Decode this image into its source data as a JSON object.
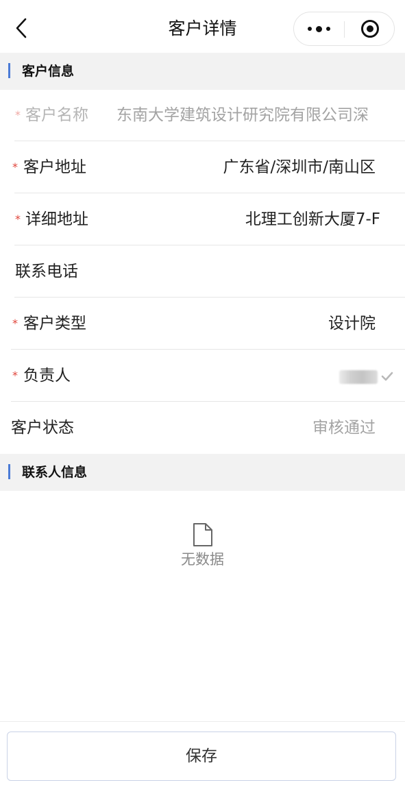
{
  "navbar": {
    "title": "客户详情"
  },
  "sections": {
    "customer_info": "客户信息",
    "contact_info": "联系人信息"
  },
  "fields": {
    "name": {
      "label": "客户名称",
      "value": "东南大学建筑设计研究院有限公司深",
      "required": true,
      "disabled": true
    },
    "address": {
      "label": "客户地址",
      "value": "广东省/深圳市/南山区",
      "required": true
    },
    "detail_address": {
      "label": "详细地址",
      "value": "北理工创新大厦7-F",
      "required": true
    },
    "phone": {
      "label": "联系电话",
      "value": ""
    },
    "type": {
      "label": "客户类型",
      "value": "设计院",
      "required": true
    },
    "owner": {
      "label": "负责人",
      "required": true
    },
    "status": {
      "label": "客户状态",
      "value": "审核通过"
    }
  },
  "required_mark": "*",
  "empty_state": {
    "text": "无数据"
  },
  "footer": {
    "save_label": "保存"
  }
}
